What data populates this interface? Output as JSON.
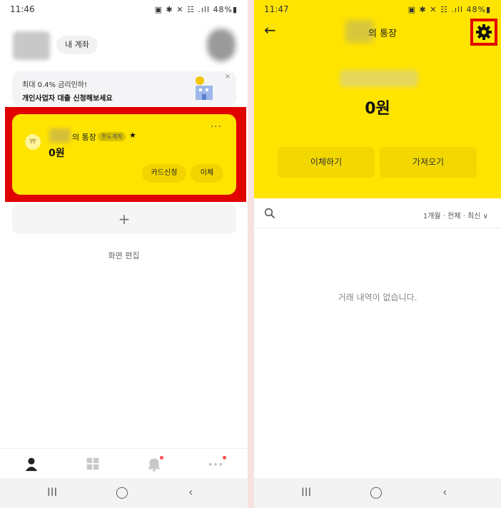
{
  "left_screen": {
    "status": {
      "time": "11:46",
      "notif_icons": "● ■ @ •",
      "system": "▣ ✱ ✕ ☷ .ıll 48%▮"
    },
    "header": {
      "my_account_button": "내 계좌"
    },
    "promo": {
      "line1": "최대 0.4% 금리인하!",
      "line2": "개인사업자 대출 신청해보세요",
      "close": "×"
    },
    "account_card": {
      "coin": "₩",
      "title": "의 통장",
      "badge": "한도계좌",
      "star": "★",
      "more": "···",
      "amount": "0원",
      "card_apply_button": "카드신청",
      "transfer_button": "이체"
    },
    "add_account": "+",
    "edit_screen": "화면 편집",
    "bottom_tabs": [
      "person-icon",
      "grid-icon",
      "bell-icon",
      "more-icon"
    ],
    "navbar": {
      "recent": "III",
      "home": "◯",
      "back": "‹"
    }
  },
  "right_screen": {
    "status": {
      "time": "11:47",
      "notif_icons": "● ■ @ •",
      "system": "▣ ✱ ✕ ☷ .ıll 48%▮"
    },
    "back_arrow": "←",
    "title": "의 통장",
    "amount": "0원",
    "transfer_button": "이체하기",
    "bring_button": "가져오기",
    "filter": "1개월 · 전체 · 최신 ∨",
    "empty_message": "거래 내역이 없습니다.",
    "navbar": {
      "recent": "III",
      "home": "◯",
      "back": "‹"
    }
  },
  "colors": {
    "brand_yellow": "#ffe400",
    "highlight_red": "#e10000"
  }
}
